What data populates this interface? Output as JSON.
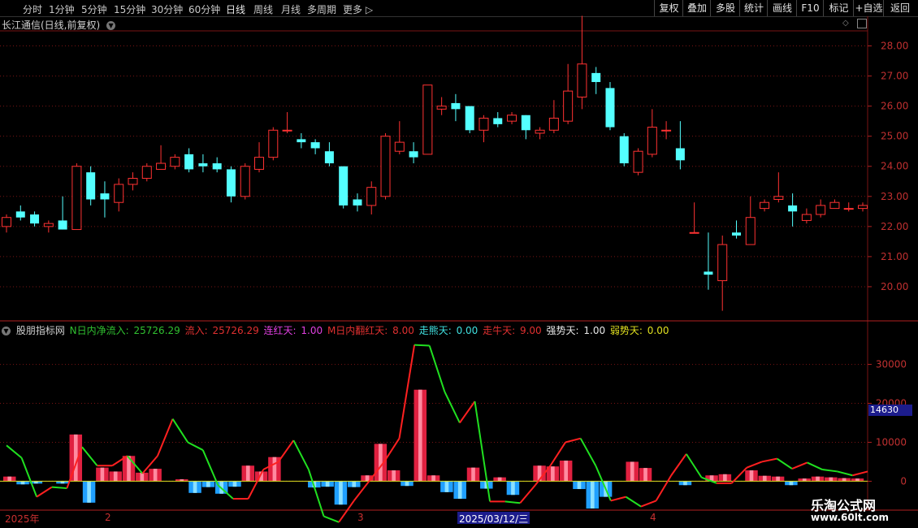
{
  "toolbar": {
    "timeframes": [
      "分时",
      "1分钟",
      "5分钟",
      "15分钟",
      "30分钟",
      "60分钟",
      "日线",
      "周线",
      "月线",
      "多周期",
      "更多"
    ],
    "active_timeframe": "日线",
    "right_buttons": [
      "复权",
      "叠加",
      "多股",
      "统计",
      "画线",
      "F10",
      "标记",
      "+自选",
      "返回"
    ]
  },
  "stock": {
    "title": "长江通信(日线,前复权)"
  },
  "indicator": {
    "name": "股朋指标网",
    "items": [
      {
        "label": "N日内净流入:",
        "value": "25726.29",
        "color": "#30c030"
      },
      {
        "label": "流入:",
        "value": "25726.29",
        "color": "#e03030"
      },
      {
        "label": "连红天:",
        "value": "1.00",
        "color": "#e040e0"
      },
      {
        "label": "M日内翻红天:",
        "value": "8.00",
        "color": "#e03030"
      },
      {
        "label": "走熊天:",
        "value": "0.00",
        "color": "#40e0e0"
      },
      {
        "label": "走牛天:",
        "value": "9.00",
        "color": "#e03030"
      },
      {
        "label": "强势天:",
        "value": "1.00",
        "color": "#e8e8e8"
      },
      {
        "label": "弱势天:",
        "value": "0.00",
        "color": "#e0e020"
      }
    ]
  },
  "price_axis": [
    "28.00",
    "27.00",
    "26.00",
    "25.00",
    "24.00",
    "23.00",
    "22.00",
    "21.00",
    "20.00"
  ],
  "ind_axis": [
    "30000",
    "20000",
    "10000",
    "0"
  ],
  "ind_current_value": "14630",
  "dates": {
    "year": "2025年",
    "m2": "2",
    "m3": "3",
    "m4": "4",
    "cursor": "2025/03/12/三"
  },
  "watermark": {
    "name": "乐淘公式网",
    "url": "www.60lt.com"
  },
  "colors": {
    "up": "#ff3232",
    "down": "#54ffff",
    "bg": "#000000",
    "grid": "#7a1414"
  },
  "chart_data": {
    "type": "candlestick+bar+line",
    "price_ylim": [
      19.0,
      28.5
    ],
    "candles": [
      [
        22.0,
        22.3,
        22.4,
        21.8
      ],
      [
        22.5,
        22.3,
        22.7,
        22.2
      ],
      [
        22.4,
        22.1,
        22.5,
        22.0
      ],
      [
        22.0,
        22.1,
        22.2,
        21.8
      ],
      [
        22.2,
        21.9,
        23.0,
        21.9
      ],
      [
        21.9,
        24.0,
        24.1,
        21.9
      ],
      [
        23.8,
        22.9,
        24.0,
        22.7
      ],
      [
        23.1,
        22.9,
        23.5,
        22.3
      ],
      [
        22.8,
        23.4,
        23.6,
        22.5
      ],
      [
        23.4,
        23.6,
        23.8,
        23.2
      ],
      [
        23.6,
        24.0,
        24.1,
        23.5
      ],
      [
        23.9,
        24.1,
        24.7,
        23.9
      ],
      [
        24.0,
        24.3,
        24.4,
        23.9
      ],
      [
        24.4,
        23.9,
        24.6,
        23.8
      ],
      [
        24.1,
        24.0,
        24.4,
        23.8
      ],
      [
        24.1,
        23.9,
        24.3,
        23.8
      ],
      [
        23.9,
        23.0,
        24.0,
        22.8
      ],
      [
        23.0,
        24.0,
        24.1,
        22.9
      ],
      [
        23.9,
        24.3,
        24.8,
        23.8
      ],
      [
        24.3,
        25.2,
        25.3,
        24.2
      ],
      [
        25.2,
        25.2,
        25.8,
        25.1
      ],
      [
        24.9,
        24.8,
        25.1,
        24.6
      ],
      [
        24.8,
        24.6,
        24.9,
        24.4
      ],
      [
        24.5,
        24.1,
        24.8,
        24.0
      ],
      [
        24.0,
        22.7,
        24.0,
        22.6
      ],
      [
        22.9,
        22.7,
        23.1,
        22.5
      ],
      [
        22.7,
        23.3,
        23.5,
        22.4
      ],
      [
        23.0,
        25.0,
        25.1,
        22.9
      ],
      [
        24.5,
        24.8,
        25.5,
        24.4
      ],
      [
        24.5,
        24.3,
        24.8,
        24.1
      ],
      [
        24.4,
        26.7,
        26.7,
        24.4
      ],
      [
        25.9,
        26.0,
        26.3,
        25.7
      ],
      [
        26.1,
        25.9,
        26.4,
        25.5
      ],
      [
        26.0,
        25.2,
        26.0,
        25.1
      ],
      [
        25.2,
        25.6,
        25.7,
        24.8
      ],
      [
        25.6,
        25.4,
        25.8,
        25.3
      ],
      [
        25.5,
        25.7,
        25.8,
        25.4
      ],
      [
        25.7,
        25.2,
        25.7,
        24.9
      ],
      [
        25.1,
        25.2,
        25.3,
        24.9
      ],
      [
        25.2,
        25.6,
        26.2,
        25.1
      ],
      [
        25.5,
        26.5,
        27.4,
        25.4
      ],
      [
        26.3,
        27.4,
        29.0,
        25.9
      ],
      [
        27.1,
        26.8,
        27.3,
        26.4
      ],
      [
        26.6,
        25.3,
        26.8,
        25.2
      ],
      [
        25.0,
        24.1,
        25.1,
        24.0
      ],
      [
        23.8,
        24.5,
        24.6,
        23.7
      ],
      [
        24.4,
        25.3,
        25.9,
        24.3
      ],
      [
        25.2,
        25.2,
        25.5,
        24.9
      ],
      [
        24.6,
        24.2,
        25.5,
        23.9
      ],
      [
        21.8,
        21.8,
        22.8,
        21.8
      ],
      [
        20.5,
        20.4,
        21.8,
        19.9
      ],
      [
        20.2,
        21.4,
        21.7,
        19.2
      ],
      [
        21.8,
        21.7,
        22.2,
        21.6
      ],
      [
        21.4,
        22.3,
        23.0,
        21.4
      ],
      [
        22.6,
        22.8,
        22.9,
        22.5
      ],
      [
        22.9,
        23.0,
        23.8,
        22.8
      ],
      [
        22.7,
        22.5,
        23.1,
        22.0
      ],
      [
        22.2,
        22.4,
        22.6,
        22.1
      ],
      [
        22.4,
        22.7,
        22.9,
        22.3
      ],
      [
        22.6,
        22.8,
        22.9,
        22.6
      ],
      [
        22.6,
        22.6,
        22.8,
        22.5
      ],
      [
        22.6,
        22.7,
        22.8,
        22.5
      ]
    ],
    "ind_ylim": [
      -7000,
      37000
    ],
    "bars": [
      1200,
      -800,
      -600,
      0,
      -600,
      12000,
      -5500,
      3500,
      2500,
      6500,
      2200,
      3200,
      0,
      500,
      -3000,
      -1500,
      -3200,
      -1400,
      4000,
      2500,
      6200,
      0,
      0,
      -1600,
      -1400,
      -6000,
      -1500,
      1500,
      9600,
      2800,
      -1200,
      23500,
      1500,
      -2800,
      -4500,
      3500,
      -1900,
      1000,
      -3500,
      0,
      4000,
      3800,
      5300,
      -2000,
      -7000,
      -4000,
      0,
      5000,
      3400,
      0,
      0,
      -1000,
      0,
      1500,
      1800,
      0,
      2800,
      1400,
      1200,
      -1000,
      700,
      1200,
      1000,
      800,
      700
    ],
    "line": [
      9200,
      6000,
      -4000,
      -1500,
      -1800,
      8800,
      4000,
      4000,
      6500,
      2000,
      6500,
      16000,
      10000,
      8000,
      -1000,
      -4500,
      -4500,
      3000,
      5000,
      10500,
      3000,
      -9000,
      -10500,
      -5000,
      0,
      5000,
      11000,
      35000,
      34800,
      23000,
      15000,
      20500,
      -5200,
      -5200,
      -5600,
      -1000,
      4000,
      10000,
      11000,
      4000,
      -5000,
      -4000,
      -6500,
      -5000,
      1500,
      7000,
      1000,
      -500,
      -500,
      3500,
      5000,
      5800,
      3200,
      4800,
      3000,
      2500,
      1500,
      2500
    ]
  }
}
